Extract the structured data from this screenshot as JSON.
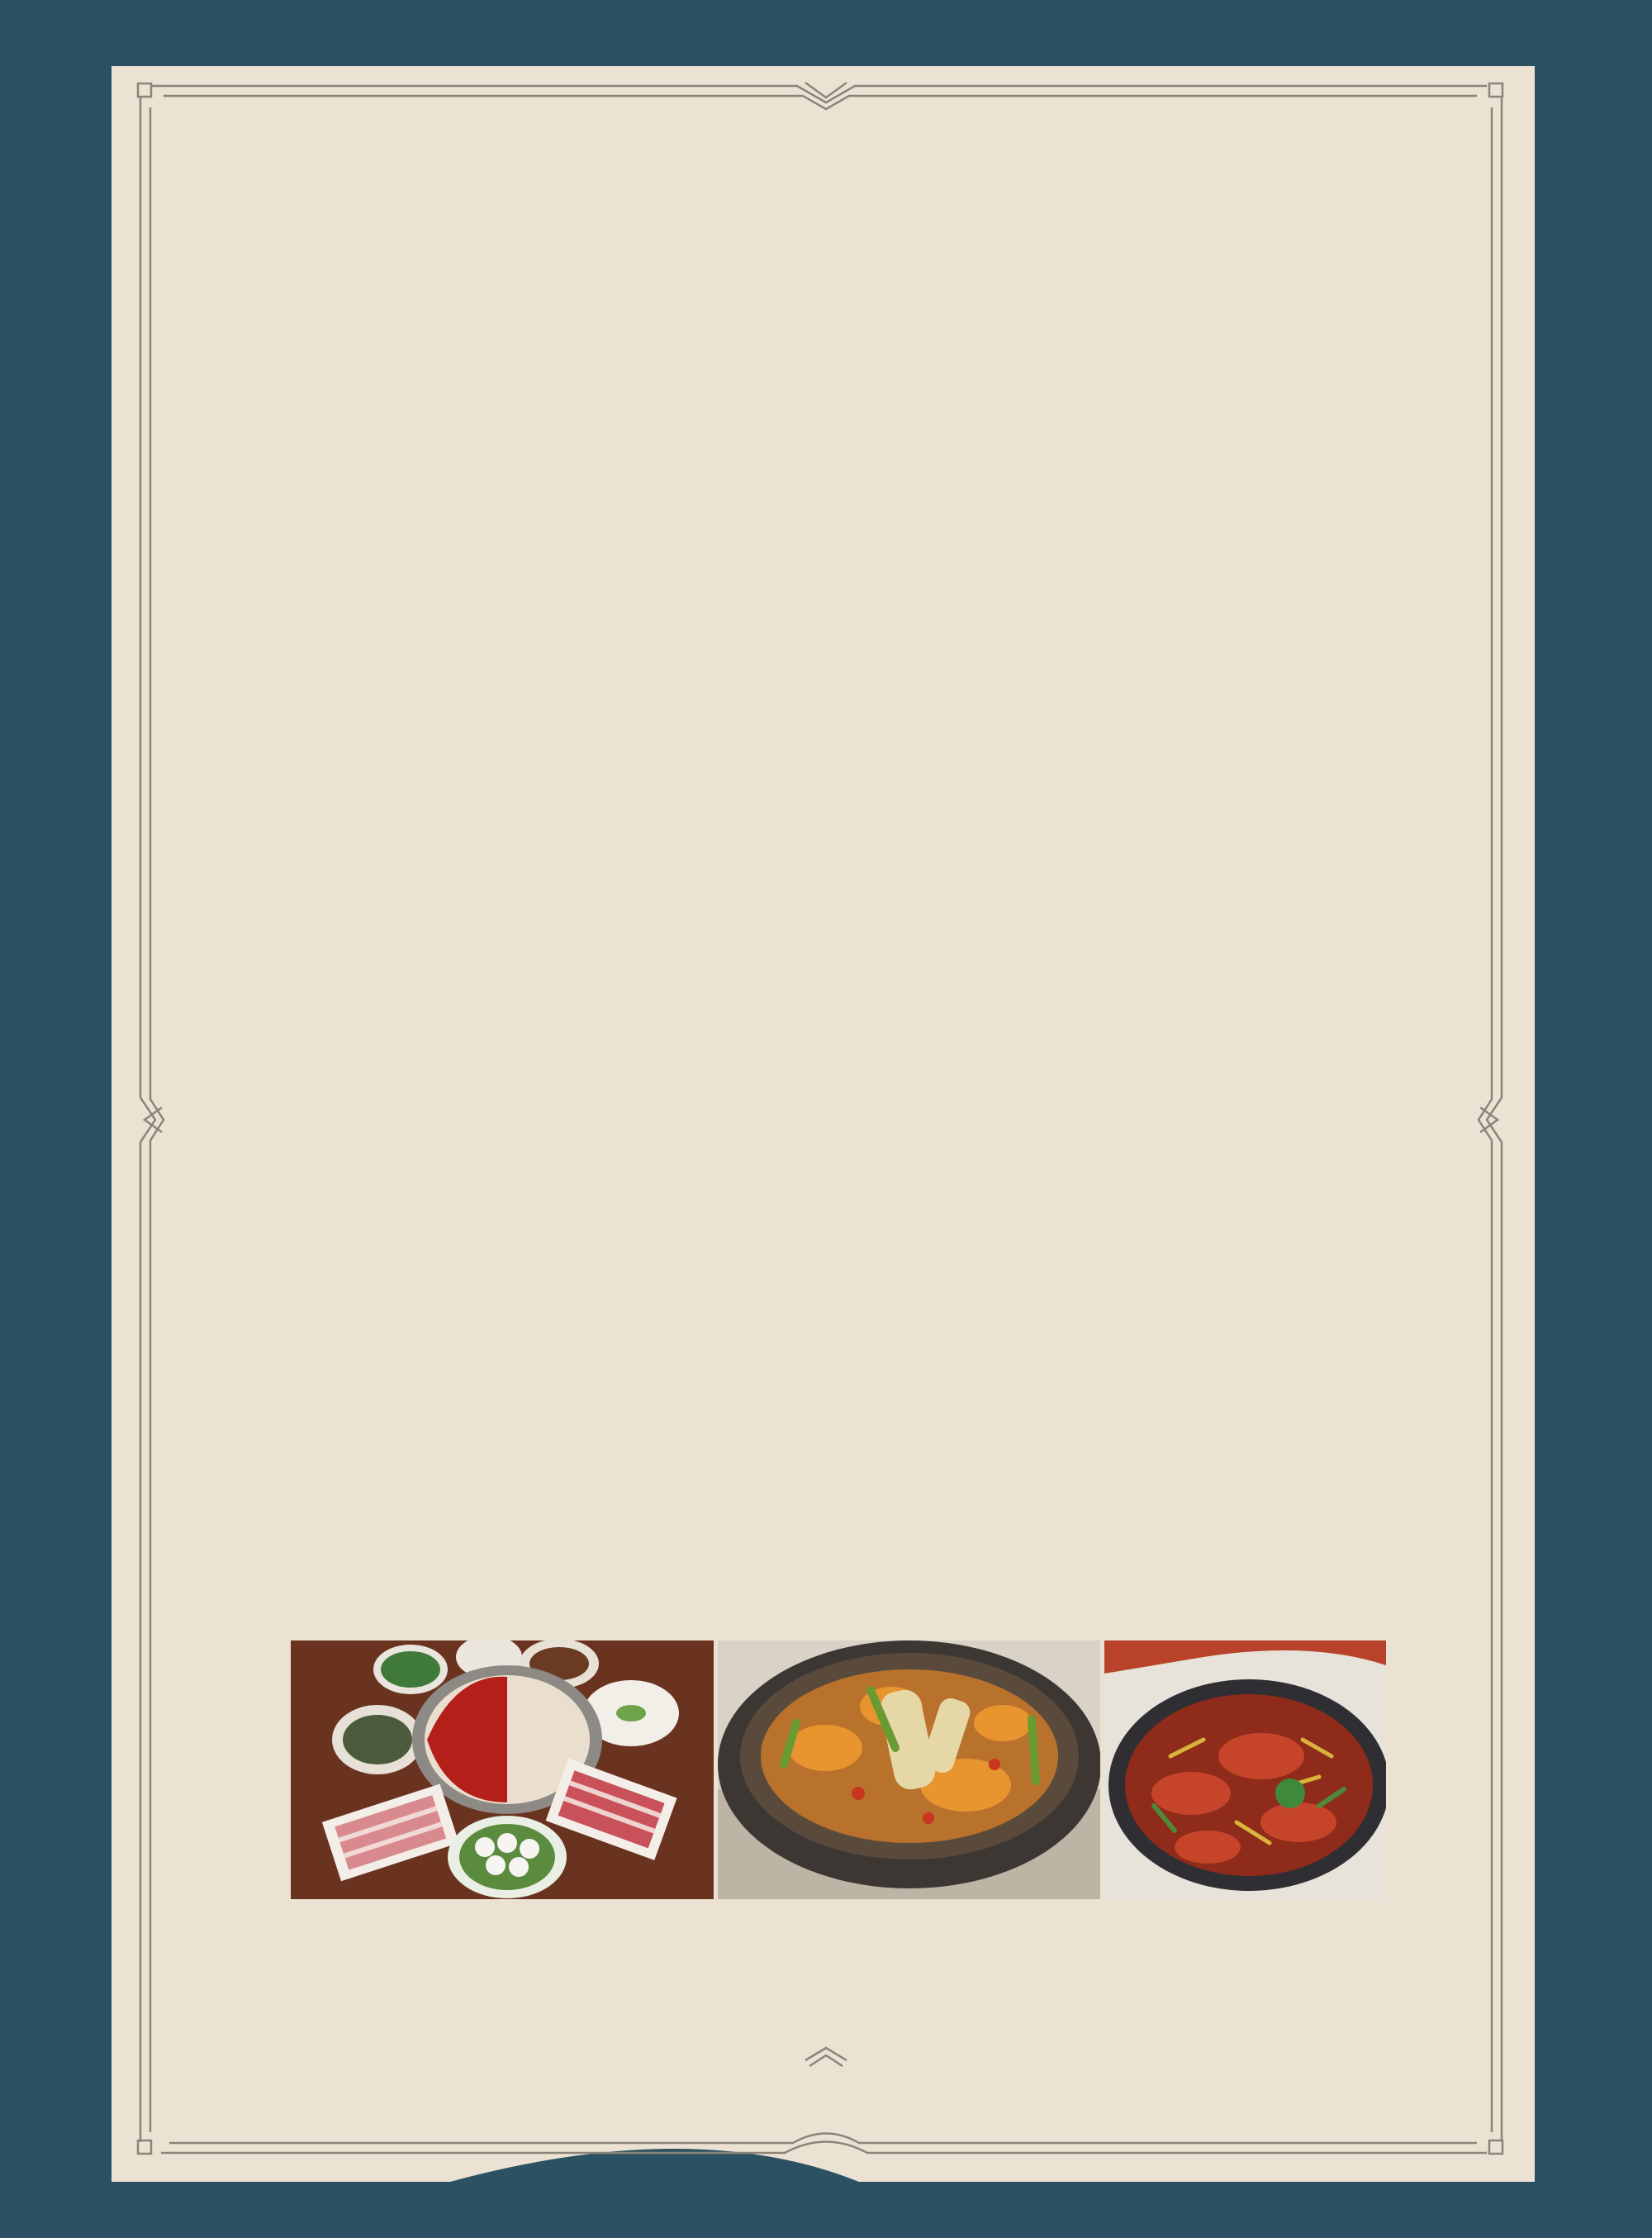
{
  "colors": {
    "background": "#2b5162",
    "paper": "#ece2d3",
    "border_line": "#8c8478"
  },
  "decorations": {
    "frame": "double-line-ornamental-border",
    "ornaments": [
      "chevron-down-ornament",
      "chevron-left-ornament",
      "chevron-right-ornament",
      "chevron-up-ornament"
    ]
  },
  "photos": [
    {
      "icon": "hotpot-photo"
    },
    {
      "icon": "stir-fried-shrimp-pot-photo"
    },
    {
      "icon": "spicy-crayfish-pan-photo"
    }
  ]
}
